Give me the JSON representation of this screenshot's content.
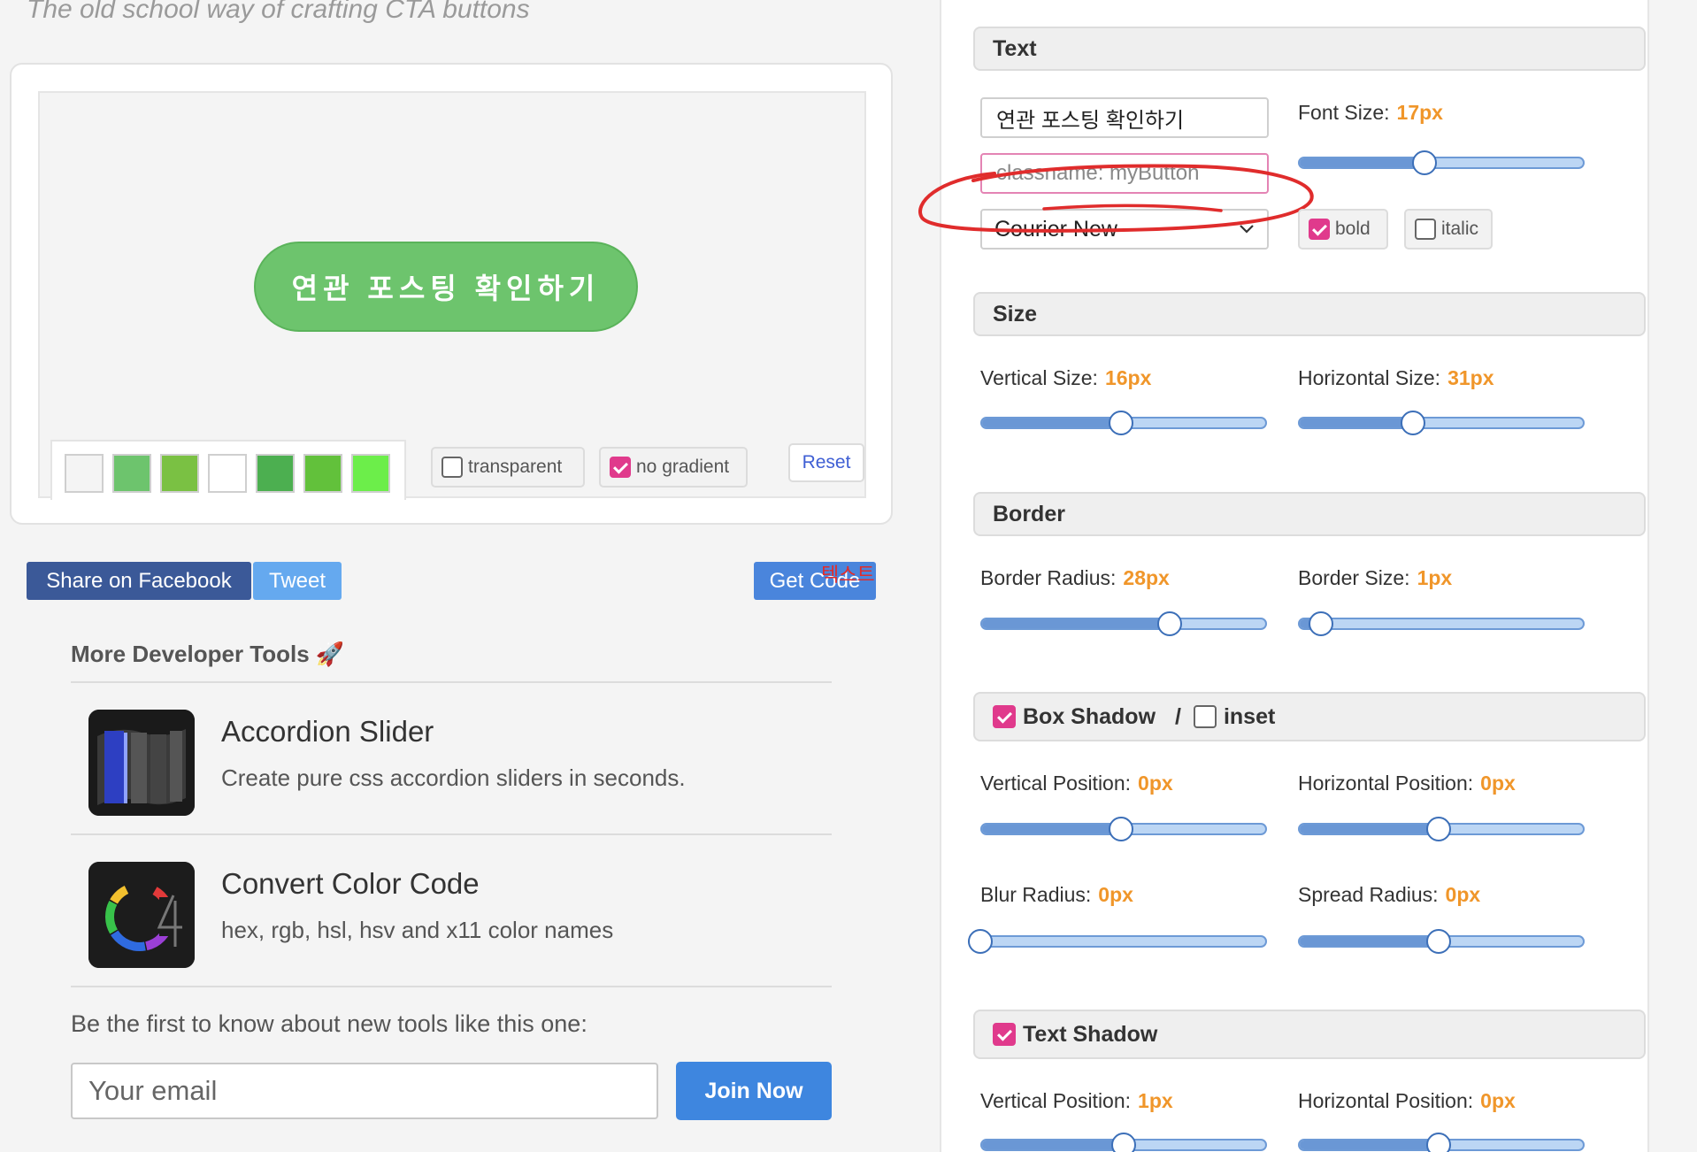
{
  "tagline": "The old school way of crafting CTA buttons",
  "preview": {
    "button_text": "연관 포스팅 확인하기",
    "swatches": [
      "#f4f4f4",
      "#6dc46d",
      "#7ac143",
      "#ffffff",
      "#4caf50",
      "#62c13b",
      "#6cee4a"
    ],
    "transparent_label": "transparent",
    "transparent_checked": false,
    "no_gradient_label": "no gradient",
    "no_gradient_checked": true,
    "reset_label": "Reset"
  },
  "share": {
    "facebook_label": "Share on Facebook",
    "tweet_label": "Tweet",
    "get_code_label": "Get Code",
    "overlay_text": "텍스트"
  },
  "tools": {
    "title": "More Developer Tools 🚀",
    "items": [
      {
        "title": "Accordion Slider",
        "desc": "Create pure css accordion sliders in seconds."
      },
      {
        "title": "Convert Color Code",
        "desc": "hex, rgb, hsl, hsv and x11 color names"
      }
    ]
  },
  "newsletter": {
    "prompt": "Be the first to know about new tools like this one:",
    "email_placeholder": "Your email",
    "join_label": "Join Now"
  },
  "panel": {
    "text": {
      "heading": "Text",
      "text_value": "연관 포스팅 확인하기",
      "classname_placeholder": "classname: myButton",
      "font_family": "Courier New",
      "font_size_label": "Font Size:",
      "font_size_value": "17px",
      "font_size_level": 0.44,
      "bold_label": "bold",
      "bold_checked": true,
      "italic_label": "italic",
      "italic_checked": false
    },
    "size": {
      "heading": "Size",
      "vertical_label": "Vertical Size:",
      "vertical_value": "16px",
      "vertical_level": 0.49,
      "horizontal_label": "Horizontal Size:",
      "horizontal_value": "31px",
      "horizontal_level": 0.4
    },
    "border": {
      "heading": "Border",
      "radius_label": "Border Radius:",
      "radius_value": "28px",
      "radius_level": 0.66,
      "size_label": "Border Size:",
      "size_value": "1px",
      "size_level": 0.08
    },
    "box_shadow": {
      "heading": "Box Shadow",
      "enabled": true,
      "separator": "/",
      "inset_label": "inset",
      "inset_checked": false,
      "vpos_label": "Vertical Position:",
      "vpos_value": "0px",
      "vpos_level": 0.49,
      "hpos_label": "Horizontal Position:",
      "hpos_value": "0px",
      "hpos_level": 0.49,
      "blur_label": "Blur Radius:",
      "blur_value": "0px",
      "blur_level": 0.0,
      "spread_label": "Spread Radius:",
      "spread_value": "0px",
      "spread_level": 0.49
    },
    "text_shadow": {
      "heading": "Text Shadow",
      "enabled": true,
      "vpos_label": "Vertical Position:",
      "vpos_value": "1px",
      "vpos_level": 0.5,
      "hpos_label": "Horizontal Position:",
      "hpos_value": "0px",
      "hpos_level": 0.49
    }
  },
  "colors": {
    "accent_pink": "#e03a8c",
    "value_orange": "#f0962a",
    "facebook_blue": "#3b5998",
    "tweet_blue": "#65a9ef",
    "get_code_blue": "#4a85dc",
    "join_blue": "#3e86df",
    "annotation_red": "#e02c2c"
  }
}
